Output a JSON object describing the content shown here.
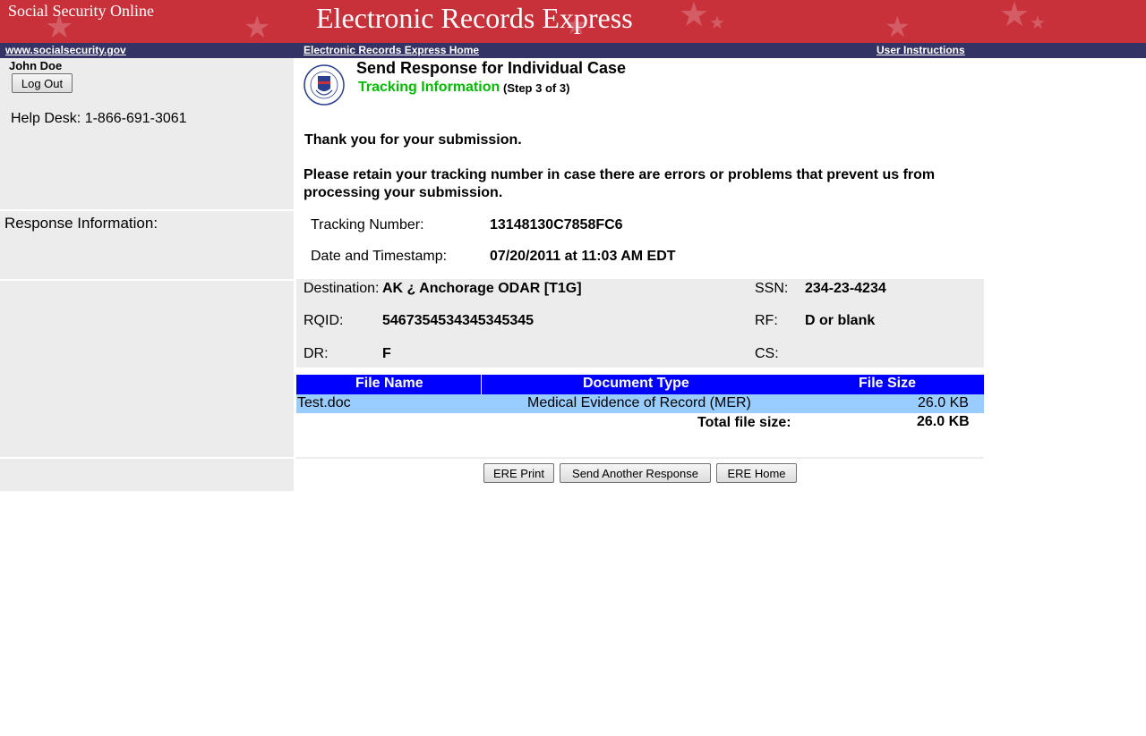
{
  "banner": {
    "site_name": "Social Security Online",
    "app_title": "Electronic Records Express"
  },
  "nav": {
    "ssa_link": "www.socialsecurity.gov",
    "home_link": "Electronic Records Express Home",
    "instructions_link": "User Instructions"
  },
  "sidebar": {
    "user_name": "John  Doe",
    "logout_label": "Log Out",
    "help_desk": "Help Desk: 1-866-691-3061",
    "response_info": "Response Information:"
  },
  "main": {
    "title": "Send Response for Individual Case",
    "step_title": "Tracking Information",
    "step_count": "(Step 3 of 3)",
    "thanks": "Thank you for your submission.",
    "retain_line1": "Please retain your tracking number in case there are errors or problems that prevent us from",
    "retain_line2": "processing your submission.",
    "tracking_label": "Tracking Number:",
    "tracking_value": "13148130C7858FC6",
    "date_label": "Date and Timestamp:",
    "date_value": "07/20/2011 at 11:03 AM EDT"
  },
  "case": {
    "destination_label": "Destination:",
    "destination_value": "AK ¿ Anchorage ODAR [T1G]",
    "ssn_label": "SSN:",
    "ssn_value": "234-23-4234",
    "rqid_label": "RQID:",
    "rqid_value": "5467354534345345345",
    "rf_label": "RF:",
    "rf_value": "D or blank",
    "dr_label": "DR:",
    "dr_value": "F",
    "cs_label": "CS:",
    "cs_value": ""
  },
  "files": {
    "headers": [
      "File Name",
      "Document Type",
      "File Size"
    ],
    "rows": [
      [
        "Test.doc",
        "Medical Evidence of Record (MER)",
        "26.0 KB"
      ]
    ],
    "total_label": "Total file size:",
    "total_value": "26.0 KB"
  },
  "actions": {
    "print": "ERE Print",
    "send_another": "Send Another Response",
    "home": "ERE Home"
  },
  "colors": {
    "banner": "#c8303a",
    "navbar": "#333366",
    "table_header": "#0000ff",
    "table_row": "#99ccff",
    "step_green": "#00bb00"
  }
}
